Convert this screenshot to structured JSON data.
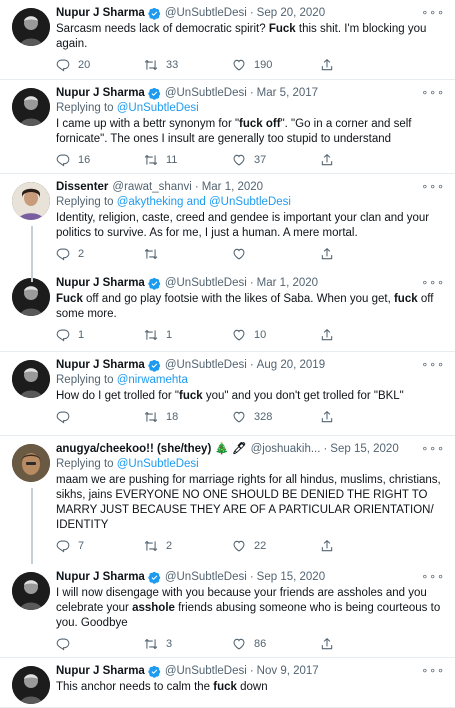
{
  "tweets": [
    {
      "name": "Nupur J Sharma",
      "handle": "@UnSubtleDesi",
      "time": "Sep 20, 2020",
      "replying_prefix": "",
      "replying_to": "",
      "text_parts": [
        "Sarcasm needs lack of democratic spirit? ",
        "Fuck",
        " this shit. I'm blocking you again."
      ],
      "replies": "20",
      "retweets": "33",
      "likes": "190"
    },
    {
      "name": "Nupur J Sharma",
      "handle": "@UnSubtleDesi",
      "time": "Mar 5, 2017",
      "replying_prefix": "Replying to ",
      "replying_to": "@UnSubtleDesi",
      "text_parts": [
        "I came up with a bettr synonym for \"",
        "fuck off",
        "\". \"Go in a corner and self fornicate\". The ones I insult are generally too stupid to understand"
      ],
      "replies": "16",
      "retweets": "11",
      "likes": "37"
    },
    {
      "name": "Dissenter",
      "handle": "@rawat_shanvi",
      "time": "Mar 1, 2020",
      "replying_prefix": "Replying to ",
      "replying_to": "@akytheking and @UnSubtleDesi",
      "text_parts": [
        "Identity, religion, caste, creed and gendee is important your clan and your politics to survive. As for me, I just a human. A mere mortal.",
        "",
        ""
      ],
      "replies": "2",
      "retweets": "",
      "likes": ""
    },
    {
      "name": "Nupur J Sharma",
      "handle": "@UnSubtleDesi",
      "time": "Mar 1, 2020",
      "replying_prefix": "",
      "replying_to": "",
      "text_parts": [
        "",
        "Fuck",
        " off and go play footsie with the likes of Saba. When you get, "
      ],
      "text_parts_b": [
        "fuck",
        " off some more."
      ],
      "replies": "1",
      "retweets": "1",
      "likes": "10"
    },
    {
      "name": "Nupur J Sharma",
      "handle": "@UnSubtleDesi",
      "time": "Aug 20, 2019",
      "replying_prefix": "Replying to ",
      "replying_to": "@nirwamehta",
      "text_parts": [
        "How do I get trolled for \"",
        "fuck",
        " you\" and you don't get trolled for \"BKL\""
      ],
      "replies": "",
      "retweets": "18",
      "likes": "328"
    },
    {
      "name": "anugya/cheekoo!! (she/they) 🎄 🖊",
      "handle": "@joshuakih...",
      "time": "Sep 15, 2020",
      "replying_prefix": "Replying to ",
      "replying_to": "@UnSubtleDesi",
      "text_parts": [
        "maam we are pushing for marriage rights for all hindus, muslims, christians, sikhs, jains EVERYONE NO ONE SHOULD BE DENIED THE RIGHT TO MARRY JUST BECAUSE THEY ARE OF A PARTICULAR ORIENTATION/ IDENTITY",
        "",
        ""
      ],
      "replies": "7",
      "retweets": "2",
      "likes": "22"
    },
    {
      "name": "Nupur J Sharma",
      "handle": "@UnSubtleDesi",
      "time": "Sep 15, 2020",
      "replying_prefix": "",
      "replying_to": "",
      "text_parts": [
        "I will now disengage with you because your friends are assholes and you celebrate your ",
        "asshole",
        " friends abusing someone who is being courteous to you. Goodbye"
      ],
      "replies": "",
      "retweets": "3",
      "likes": "86"
    },
    {
      "name": "Nupur J Sharma",
      "handle": "@UnSubtleDesi",
      "time": "Nov 9, 2017",
      "replying_prefix": "",
      "replying_to": "",
      "text_parts": [
        "This anchor needs to calm the ",
        "fuck",
        " down"
      ],
      "replies": "",
      "retweets": "",
      "likes": ""
    }
  ],
  "more_label": "∘∘∘",
  "dot": "·",
  "colors": {
    "accent": "#1d9bf0",
    "muted": "#536471",
    "border": "#e6ecf0"
  }
}
